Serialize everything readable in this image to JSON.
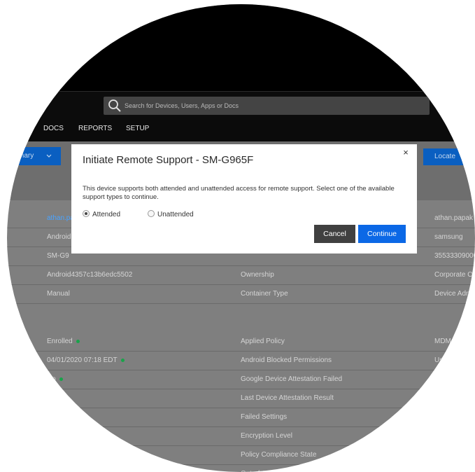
{
  "search": {
    "placeholder": "Search for Devices, Users, Apps or Docs"
  },
  "nav": [
    "DOCS",
    "REPORTS",
    "SETUP"
  ],
  "toolbar": {
    "summary_label": "mary",
    "locate_label": "Locate"
  },
  "rows": [
    {
      "value_left": "athan.pa",
      "label_mid": "",
      "value_right": "athan.papak"
    },
    {
      "value_left": "Android",
      "label_mid": "",
      "value_right": "samsung"
    },
    {
      "value_left": "SM-G9",
      "label_mid": "",
      "value_right": "35533309000"
    },
    {
      "value_left": "Android4357c13b6edc5502",
      "label_mid": "Ownership",
      "value_right": "Corporate O"
    },
    {
      "value_left": "Manual",
      "label_mid": "Container Type",
      "value_right": "Device Adm"
    },
    {
      "value_left": "Enrolled",
      "dot": true,
      "label_mid": "Applied Policy",
      "value_right": "MDM"
    },
    {
      "value_left": "04/01/2020 07:18 EDT",
      "dot": true,
      "label_mid": "Android Blocked Permissions",
      "value_right": "Us"
    },
    {
      "value_left": "No",
      "dot": true,
      "label_mid": "Google Device Attestation Failed",
      "value_right": ""
    },
    {
      "value_left": "",
      "label_mid": "Last Device Attestation Result",
      "value_right": ""
    },
    {
      "value_left": "ted",
      "label_mid": "Failed Settings",
      "value_right": ""
    },
    {
      "value_left": "",
      "label_mid": "Encryption Level",
      "value_right": ""
    },
    {
      "value_left": "",
      "label_mid": "Policy Compliance State",
      "value_right": ""
    },
    {
      "value_left": "",
      "label_mid": "Out of Complianc",
      "value_right": ""
    }
  ],
  "modal": {
    "title": "Initiate Remote Support - SM-G965F",
    "description": "This device supports both attended and unattended access for remote support. Select one of the available support types to continue.",
    "options": [
      {
        "label": "Attended",
        "selected": true
      },
      {
        "label": "Unattended",
        "selected": false
      }
    ],
    "cancel_label": "Cancel",
    "continue_label": "Continue",
    "close_symbol": "×"
  },
  "colors": {
    "accent": "#0b68e6",
    "toolbar_blue": "#0a5fc1",
    "status_green": "#19a34a"
  }
}
